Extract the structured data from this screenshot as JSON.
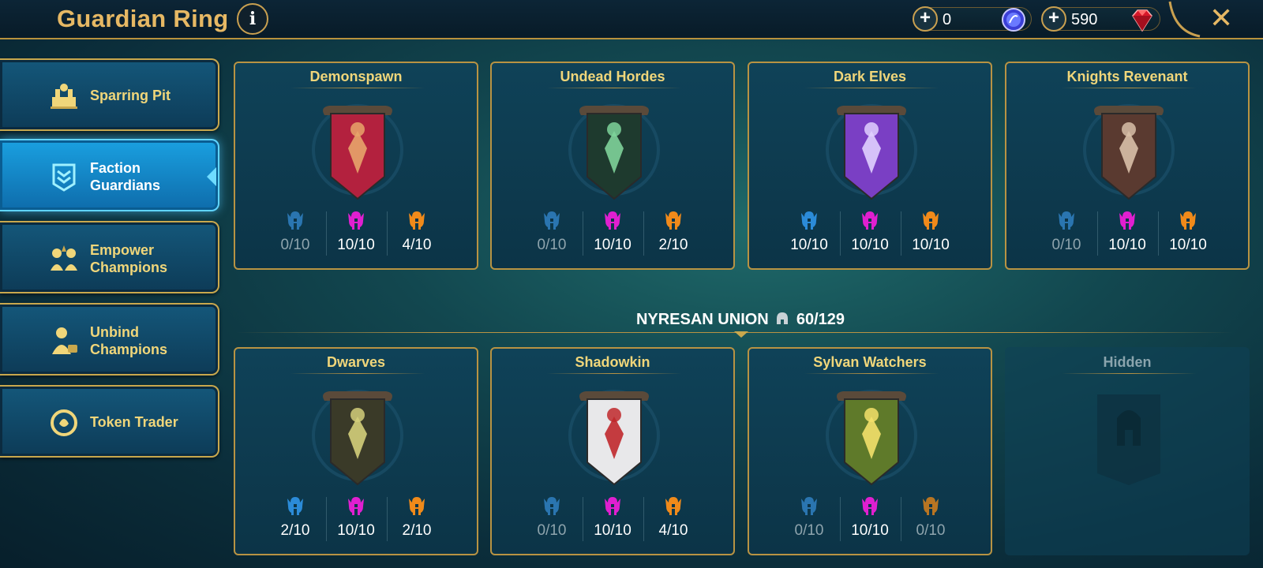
{
  "header": {
    "title": "Guardian Ring",
    "info_glyph": "i",
    "close_glyph": "✕",
    "currencies": [
      {
        "name": "silver-coin",
        "value": "0",
        "icon": "blue-coin-icon"
      },
      {
        "name": "gems",
        "value": "590",
        "icon": "red-gem-icon"
      }
    ],
    "plus_glyph": "+"
  },
  "sidebar": {
    "items": [
      {
        "label_1": "Sparring Pit",
        "label_2": "",
        "icon": "sparring-pit-icon",
        "active": false
      },
      {
        "label_1": "Faction",
        "label_2": "Guardians",
        "icon": "faction-guardians-icon",
        "active": true
      },
      {
        "label_1": "Empower",
        "label_2": "Champions",
        "icon": "empower-champions-icon",
        "active": false
      },
      {
        "label_1": "Unbind",
        "label_2": "Champions",
        "icon": "unbind-champions-icon",
        "active": false
      },
      {
        "label_1": "Token Trader",
        "label_2": "",
        "icon": "token-trader-icon",
        "active": false
      }
    ]
  },
  "union": {
    "label": "NYRESAN UNION",
    "count": "60/129"
  },
  "factions": [
    {
      "name": "Demonspawn",
      "stats": [
        "0/10",
        "10/10",
        "4/10"
      ],
      "banner_color": "#b3213e",
      "accent": "#e7a46a"
    },
    {
      "name": "Undead Hordes",
      "stats": [
        "0/10",
        "10/10",
        "2/10"
      ],
      "banner_color": "#1e3a2e",
      "accent": "#7ed39a"
    },
    {
      "name": "Dark Elves",
      "stats": [
        "10/10",
        "10/10",
        "10/10"
      ],
      "banner_color": "#7a3fc4",
      "accent": "#e0d0ff"
    },
    {
      "name": "Knights Revenant",
      "stats": [
        "0/10",
        "10/10",
        "10/10"
      ],
      "banner_color": "#5a3a30",
      "accent": "#d8c0a8"
    },
    {
      "name": "Dwarves",
      "stats": [
        "2/10",
        "10/10",
        "2/10"
      ],
      "banner_color": "#3a3a28",
      "accent": "#d4cf7a"
    },
    {
      "name": "Shadowkin",
      "stats": [
        "0/10",
        "10/10",
        "4/10"
      ],
      "banner_color": "#e8e8ea",
      "accent": "#c0282c"
    },
    {
      "name": "Sylvan Watchers",
      "stats": [
        "0/10",
        "10/10",
        "0/10"
      ],
      "banner_color": "#5f7a2a",
      "accent": "#f3e06a"
    },
    {
      "name": "Hidden",
      "stats": [],
      "banner_color": "#0f3a48",
      "accent": "#0f3a48"
    }
  ],
  "helm_colors": [
    "#2b8bd8",
    "#e01fd0",
    "#f08a1a"
  ],
  "helm_colors_dim": [
    "#2a75b0",
    "#e01fd0",
    "#b87522"
  ]
}
